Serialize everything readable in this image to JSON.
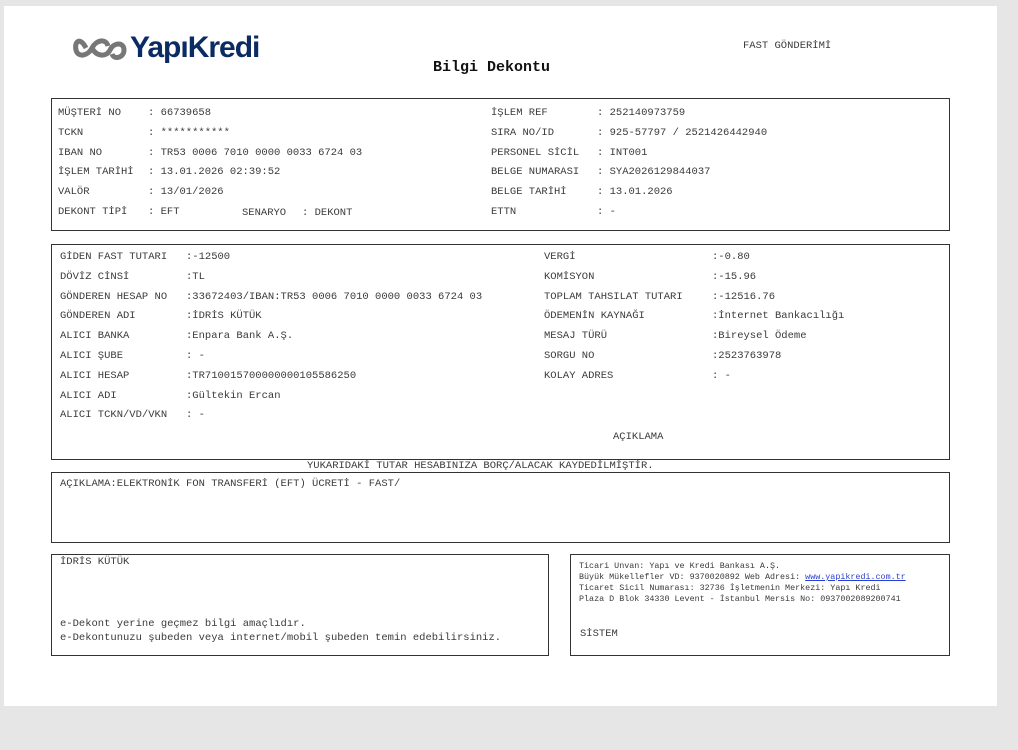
{
  "header": {
    "bank_name": "YapıKredi",
    "title": "Bilgi Dekontu",
    "doc_type": "FAST GÖNDERİMİ"
  },
  "top_left": [
    {
      "label": "MÜŞTERİ NO",
      "value": ": 66739658"
    },
    {
      "label": "TCKN",
      "value": ": ***********"
    },
    {
      "label": "IBAN NO",
      "value": ": TR53 0006 7010 0000 0033 6724 03"
    },
    {
      "label": "İŞLEM TARİHİ",
      "value": ": 13.01.2026 02:39:52"
    },
    {
      "label": "VALÖR",
      "value": ": 13/01/2026"
    },
    {
      "label": "DEKONT TİPİ",
      "value": ": EFT"
    }
  ],
  "scenario": {
    "label": "SENARYO",
    "value": ": DEKONT"
  },
  "top_right": [
    {
      "label": "İŞLEM REF",
      "value": ": 252140973759"
    },
    {
      "label": "SIRA NO/ID",
      "value": ": 925-57797 / 2521426442940"
    },
    {
      "label": "PERSONEL SİCİL",
      "value": ": INT001"
    },
    {
      "label": "BELGE NUMARASI",
      "value": ": SYA2026129844037"
    },
    {
      "label": "BELGE TARİHİ",
      "value": ": 13.01.2026"
    },
    {
      "label": "ETTN",
      "value": ": -"
    }
  ],
  "details_left": [
    {
      "label": "GİDEN FAST TUTARI",
      "value": ":-12500"
    },
    {
      "label": "DÖVİZ CİNSİ",
      "value": ":TL"
    },
    {
      "label": "GÖNDEREN HESAP NO",
      "value": ":33672403/IBAN:TR53 0006 7010 0000 0033 6724 03"
    },
    {
      "label": "GÖNDEREN ADI",
      "value": ":İDRİS KÜTÜK"
    },
    {
      "label": "ALICI BANKA",
      "value": ":Enpara Bank A.Ş."
    },
    {
      "label": "ALICI ŞUBE",
      "value": ": -"
    },
    {
      "label": "ALICI HESAP",
      "value": ":TR710015700000000105586250"
    },
    {
      "label": "ALICI ADI",
      "value": ":Gültekin Ercan"
    },
    {
      "label": "ALICI TCKN/VD/VKN",
      "value": ": -"
    }
  ],
  "details_right": [
    {
      "label": "VERGİ",
      "value": ":-0.80"
    },
    {
      "label": "KOMİSYON",
      "value": ":-15.96"
    },
    {
      "label": "TOPLAM TAHSILAT TUTARI",
      "value": ":-12516.76"
    },
    {
      "label": "ÖDEMENİN KAYNAĞI",
      "value": ":İnternet Bankacılığı"
    },
    {
      "label": "MESAJ TÜRÜ",
      "value": ":Bireysel Ödeme"
    },
    {
      "label": "SORGU NO",
      "value": ":2523763978"
    },
    {
      "label": "KOLAY ADRES",
      "value": ": -"
    }
  ],
  "aciklama_heading": "AÇIKLAMA",
  "notice": "YUKARIDAKİ TUTAR HESABINIZA BORÇ/ALACAK KAYDEDİLMİŞTİR.",
  "description": "AÇIKLAMA:ELEKTRONİK FON TRANSFERİ (EFT) ÜCRETİ - FAST/",
  "footer_left": {
    "name": "İDRİS KÜTÜK",
    "line1": "e-Dekont yerine geçmez bilgi amaçlıdır.",
    "line2": "e-Dekontunuzu şubeden veya internet/mobil şubeden temin edebilirsiniz."
  },
  "footer_right": {
    "line1": "Ticari Unvan: Yapı ve Kredi Bankası A.Ş.",
    "line2_prefix": "Büyük Mükellefler VD: 9370020892 Web Adresi: ",
    "website": "www.yapikredi.com.tr",
    "line3": "Ticaret Sicil Numarası: 32736 İşletmenin Merkezi: Yapı Kredi",
    "line4": "Plaza D Blok 34330 Levent - İstanbul Mersis No: 0937002089200741",
    "signature": "SİSTEM"
  },
  "colors": {
    "logo": "#0b2b63",
    "link": "#2a3fd6",
    "border": "#333333"
  }
}
